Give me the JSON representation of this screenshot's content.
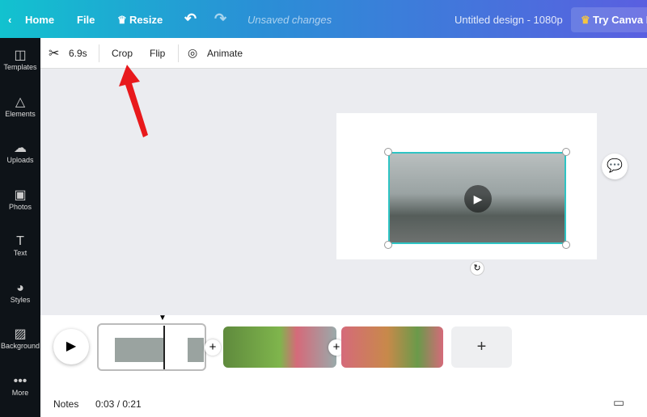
{
  "topbar": {
    "home": "Home",
    "file": "File",
    "resize": "Resize",
    "status": "Unsaved changes",
    "title": "Untitled design - 1080p",
    "cta": "Try Canva Pro"
  },
  "sidebar": {
    "items": [
      {
        "label": "Templates",
        "icon": "template-icon"
      },
      {
        "label": "Elements",
        "icon": "shapes-icon"
      },
      {
        "label": "Uploads",
        "icon": "cloud-upload-icon"
      },
      {
        "label": "Photos",
        "icon": "image-icon"
      },
      {
        "label": "Text",
        "icon": "text-icon"
      },
      {
        "label": "Styles",
        "icon": "palette-icon"
      },
      {
        "label": "Background",
        "icon": "hatch-icon"
      },
      {
        "label": "More",
        "icon": "dots-icon"
      }
    ]
  },
  "toolbar": {
    "duration": "6.9s",
    "crop": "Crop",
    "flip": "Flip",
    "animate": "Animate"
  },
  "footer": {
    "notes": "Notes",
    "time": "0:03 / 0:21"
  },
  "colors": {
    "accent": "#2ec4c4",
    "arrow": "#e8191c"
  }
}
